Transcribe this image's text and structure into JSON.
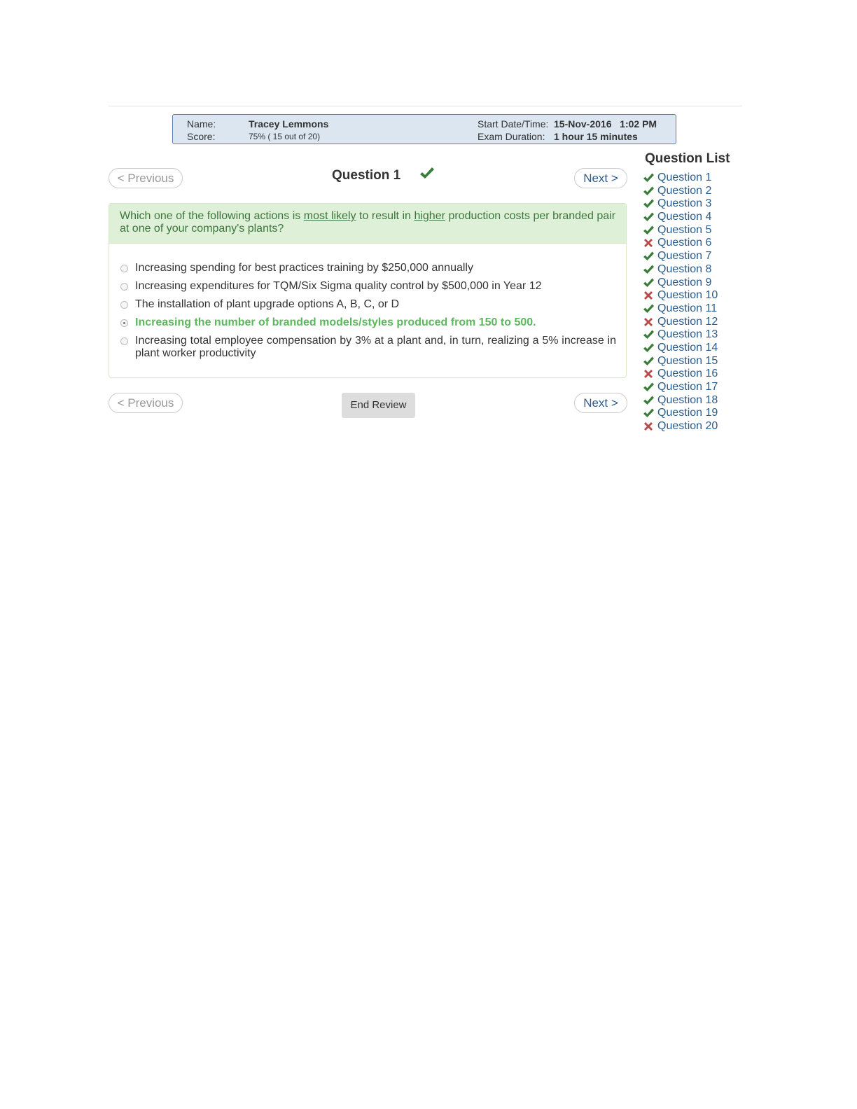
{
  "info": {
    "name_label": "Name:",
    "name_value": "Tracey Lemmons",
    "score_label": "Score:",
    "score_value": "75% ( 15 out of 20)",
    "start_label": "Start Date/Time:",
    "start_value": "15-Nov-2016   1:02 PM",
    "duration_label": "Exam Duration:",
    "duration_value": "1 hour 15 minutes"
  },
  "nav": {
    "previous_label": "< Previous",
    "next_label": "Next >",
    "end_review_label": "End Review"
  },
  "question": {
    "title": "Question 1",
    "status": "correct",
    "text_parts": [
      "Which one of the following actions is ",
      "most likely",
      " to result in ",
      "higher",
      " production costs per branded pair at one of your company's plants?"
    ],
    "options": [
      "Increasing spending for best practices training by $250,000 annually",
      "Increasing expenditures for TQM/Six Sigma quality control by $500,000 in Year 12",
      "The installation of plant upgrade options A, B, C, or D",
      "Increasing the number of branded models/styles produced from 150 to 500.",
      "Increasing total employee compensation by 3% at a plant and, in turn, realizing a 5% increase in plant worker productivity"
    ],
    "selected_index": 3
  },
  "question_list": {
    "title": "Question List",
    "items": [
      {
        "label": "Question 1",
        "status": "correct"
      },
      {
        "label": "Question 2",
        "status": "correct"
      },
      {
        "label": "Question 3",
        "status": "correct"
      },
      {
        "label": "Question 4",
        "status": "correct"
      },
      {
        "label": "Question 5",
        "status": "correct"
      },
      {
        "label": "Question 6",
        "status": "incorrect"
      },
      {
        "label": "Question 7",
        "status": "correct"
      },
      {
        "label": "Question 8",
        "status": "correct"
      },
      {
        "label": "Question 9",
        "status": "correct"
      },
      {
        "label": "Question 10",
        "status": "incorrect"
      },
      {
        "label": "Question 11",
        "status": "correct"
      },
      {
        "label": "Question 12",
        "status": "incorrect"
      },
      {
        "label": "Question 13",
        "status": "correct"
      },
      {
        "label": "Question 14",
        "status": "correct"
      },
      {
        "label": "Question 15",
        "status": "correct"
      },
      {
        "label": "Question 16",
        "status": "incorrect"
      },
      {
        "label": "Question 17",
        "status": "correct"
      },
      {
        "label": "Question 18",
        "status": "correct"
      },
      {
        "label": "Question 19",
        "status": "correct"
      },
      {
        "label": "Question 20",
        "status": "incorrect"
      }
    ]
  },
  "colors": {
    "correct": "#3a7d3a",
    "incorrect": "#b94a48",
    "link": "#2a5d8f",
    "correct_answer_text": "#5cb85c"
  }
}
